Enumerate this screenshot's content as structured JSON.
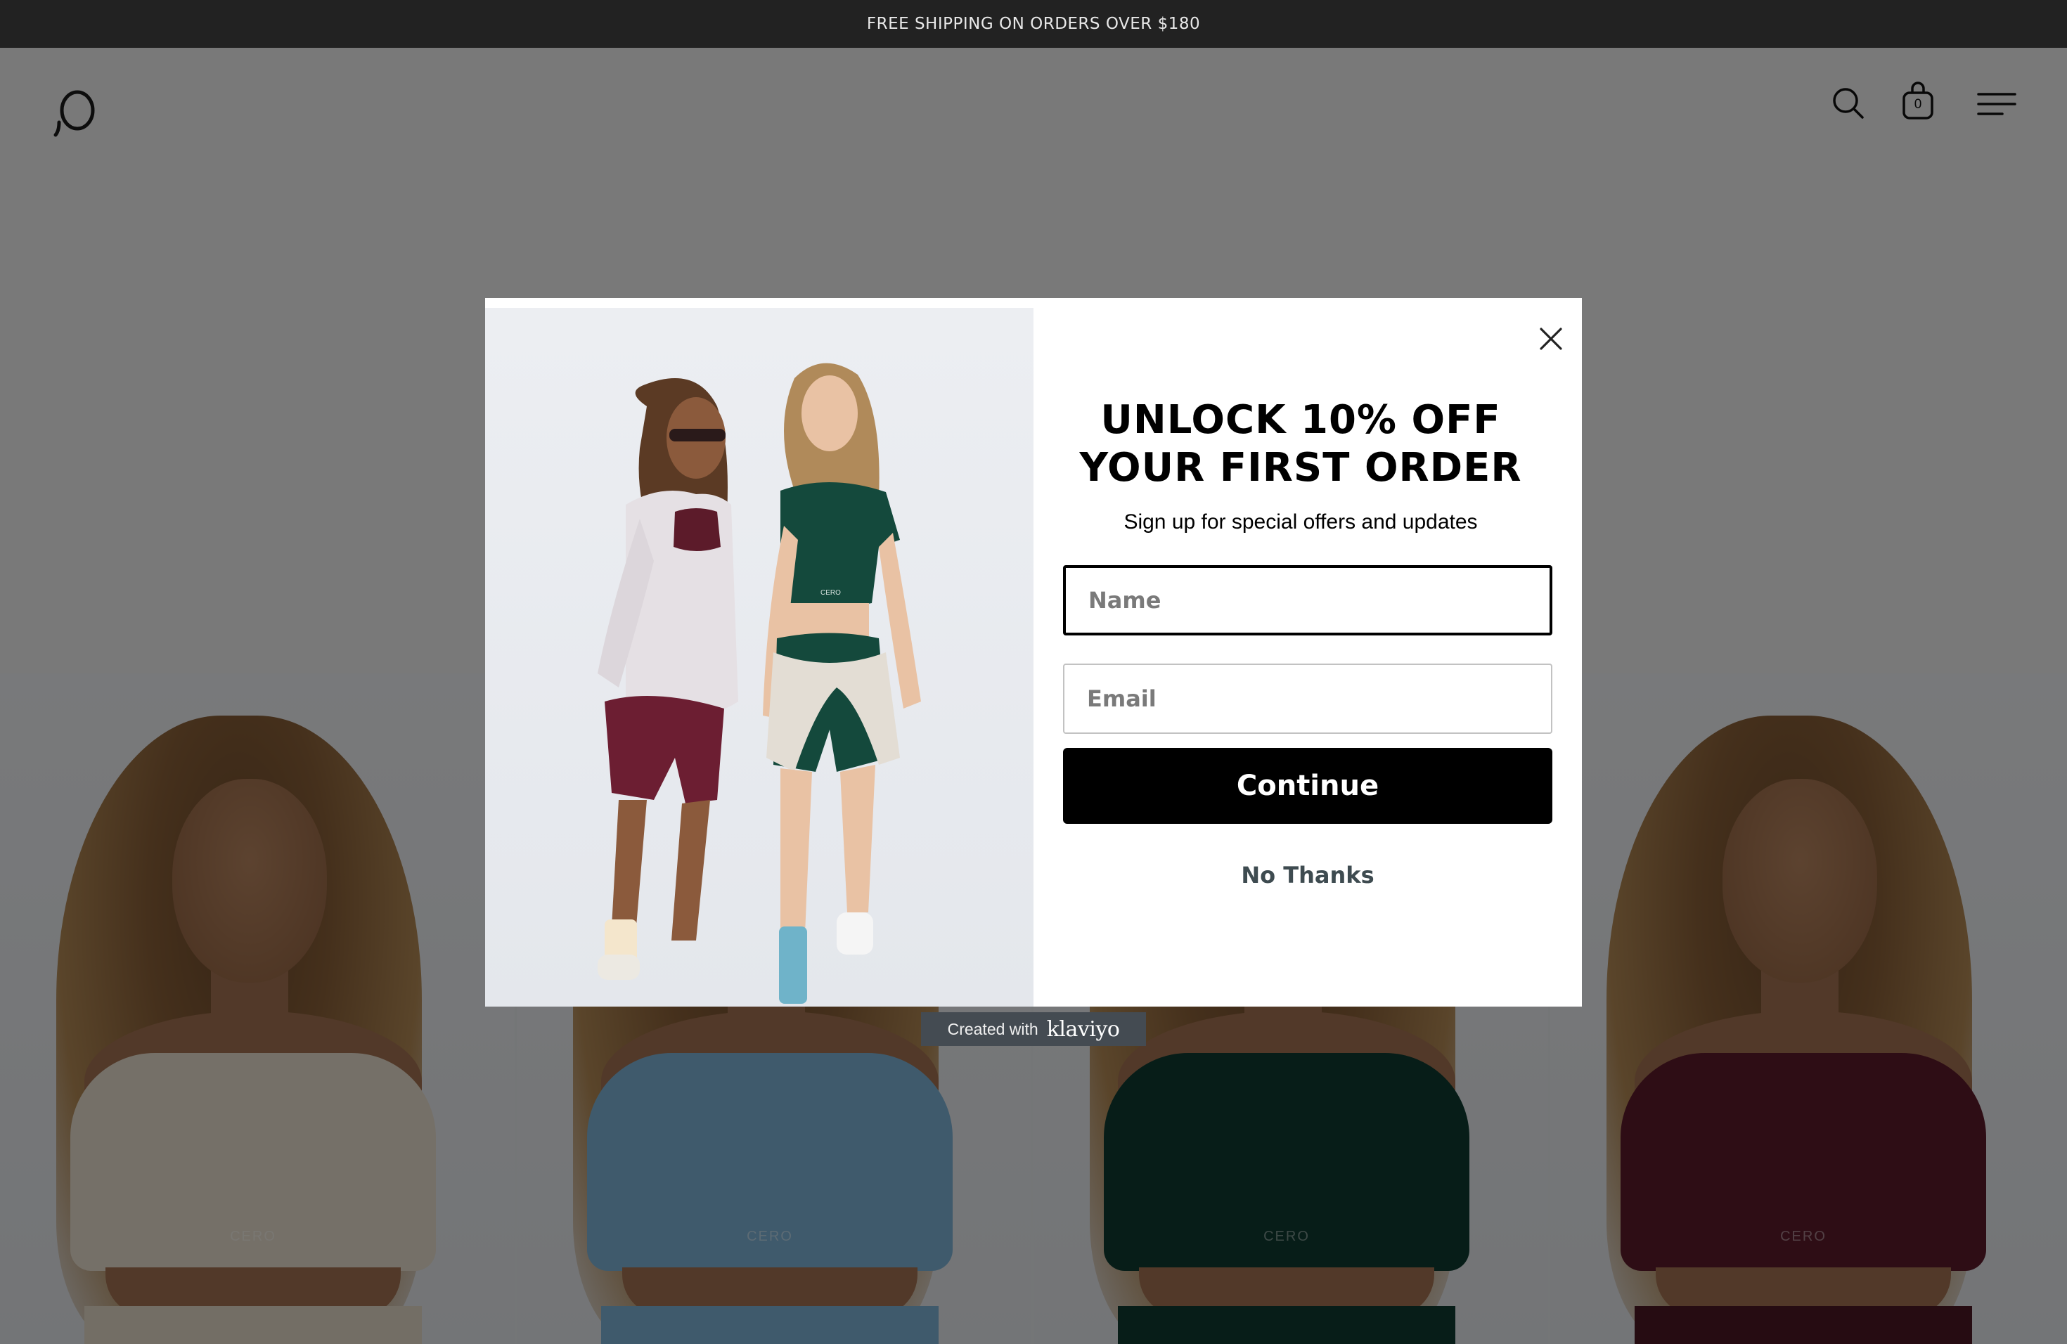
{
  "announcement": {
    "text": "FREE SHIPPING ON ORDERS OVER $180"
  },
  "header": {
    "cart_count": "0",
    "icons": [
      "logo",
      "search-icon",
      "bag-icon",
      "menu-icon"
    ]
  },
  "product_tiles": [
    {
      "top_color": "#eae0d0",
      "bottom_color": "#e6dccb",
      "brand": "CERO"
    },
    {
      "top_color": "#7fb4d8",
      "bottom_color": "#7fb4d8",
      "brand": "CERO"
    },
    {
      "top_color": "#0f3b31",
      "bottom_color": "#0f3b31",
      "brand": "CERO"
    },
    {
      "top_color": "#5c1b2a",
      "bottom_color": "#4c1824",
      "brand": "CERO"
    }
  ],
  "modal": {
    "headline_line1": "UNLOCK 10% OFF",
    "headline_line2": "YOUR FIRST ORDER",
    "subtitle": "Sign up for special offers and updates",
    "name_placeholder": "Name",
    "email_placeholder": "Email",
    "cta_label": "Continue",
    "decline_label": "No Thanks",
    "image_brand": "CERO"
  },
  "badge": {
    "created_with": "Created with",
    "brand": "klaviyo"
  },
  "colors": {
    "overlay": "rgba(0,0,0,0.5)",
    "cta_bg": "#000000",
    "decline_text": "#3e4b50"
  }
}
